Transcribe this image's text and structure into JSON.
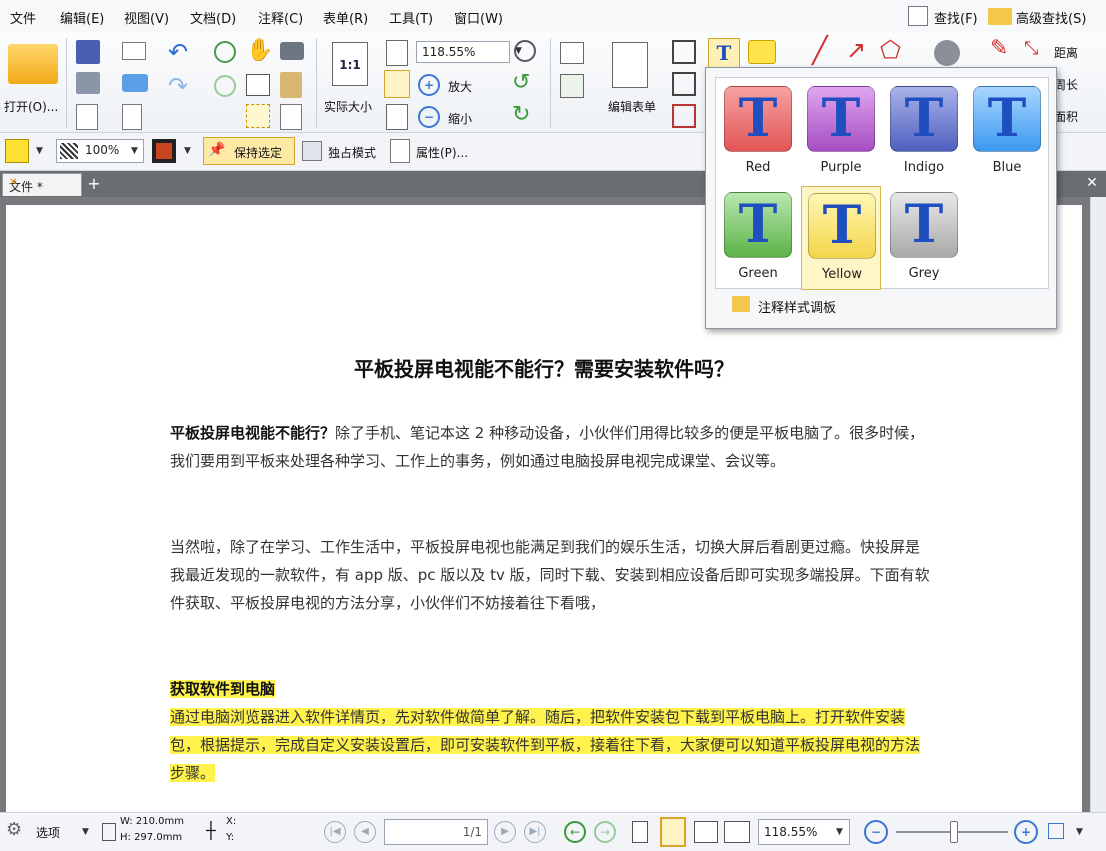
{
  "menu": [
    "文件",
    "编辑(E)",
    "视图(V)",
    "文档(D)",
    "注释(C)",
    "表单(R)",
    "工具(T)",
    "窗口(W)"
  ],
  "menu_right": {
    "find": "查找(F)",
    "advanced_find": "高级查找(S)"
  },
  "ribbon": {
    "open_label": "打开(O)...",
    "actual_size_label": "实际大小",
    "zoom_value": "118.55%",
    "zoom_in_label": "放大",
    "zoom_out_label": "缩小",
    "edit_form_label": "编辑表单",
    "distance_label": "距离",
    "perimeter_label": "周长",
    "area_label": "面积"
  },
  "toolbar2": {
    "opacity": "100%",
    "keep_selected": "保持选定",
    "exclusive_mode": "独占模式",
    "properties": "属性(P)..."
  },
  "tab": {
    "title": "文件 *"
  },
  "popup": {
    "styles": [
      {
        "name": "Red",
        "top": "#f7a1a1",
        "bottom": "#e25656",
        "selected": false
      },
      {
        "name": "Purple",
        "top": "#e0a6ef",
        "bottom": "#a54dc2",
        "selected": false
      },
      {
        "name": "Indigo",
        "top": "#a9b3e9",
        "bottom": "#4f5fbf",
        "selected": false
      },
      {
        "name": "Blue",
        "top": "#a8d6ff",
        "bottom": "#3b98f0",
        "selected": false
      },
      {
        "name": "Green",
        "top": "#b9e7ae",
        "bottom": "#5cb349",
        "selected": false
      },
      {
        "name": "Yellow",
        "top": "#fff7b3",
        "bottom": "#f3d64a",
        "selected": true
      },
      {
        "name": "Grey",
        "top": "#e8e8e8",
        "bottom": "#a9a9a9",
        "selected": false
      }
    ],
    "footer_label": "注释样式调板"
  },
  "document": {
    "title": "平板投屏电视能不能行？需要安装软件吗？",
    "p1_bold": "平板投屏电视能不能行？",
    "p1_text": "除了手机、笔记本这 2 种移动设备，小伙伴们用得比较多的便是平板电脑了。很多时候，我们要用到平板来处理各种学习、工作上的事务，例如通过电脑投屏电视完成课堂、会议等。",
    "p2": "当然啦，除了在学习、工作生活中，平板投屏电视也能满足到我们的娱乐生活，切换大屏后看剧更过瘾。快投屏是我最近发现的一款软件，有 app 版、pc 版以及 tv 版，同时下载、安装到相应设备后即可实现多端投屏。下面有软件获取、平板投屏电视的方法分享，小伙伴们不妨接着往下看哦，",
    "h2": "获取软件到电脑",
    "p3": "通过电脑浏览器进入软件详情页，先对软件做简单了解。随后，把软件安装包下载到平板电脑上。打开软件安装包，根据提示，完成自定义安装设置后，即可安装软件到平板，接着往下看，大家便可以知道平板投屏电视的方法步骤。"
  },
  "status": {
    "select_label": "选项",
    "width": "W: 210.0mm",
    "height": "H: 297.0mm",
    "x": "X:",
    "y": "Y:",
    "page": "1/1",
    "zoom": "118.55%"
  },
  "colors": {
    "highlight": "#fff24d",
    "accent": "#f0b400",
    "icon_blue": "#1f4fbf"
  }
}
